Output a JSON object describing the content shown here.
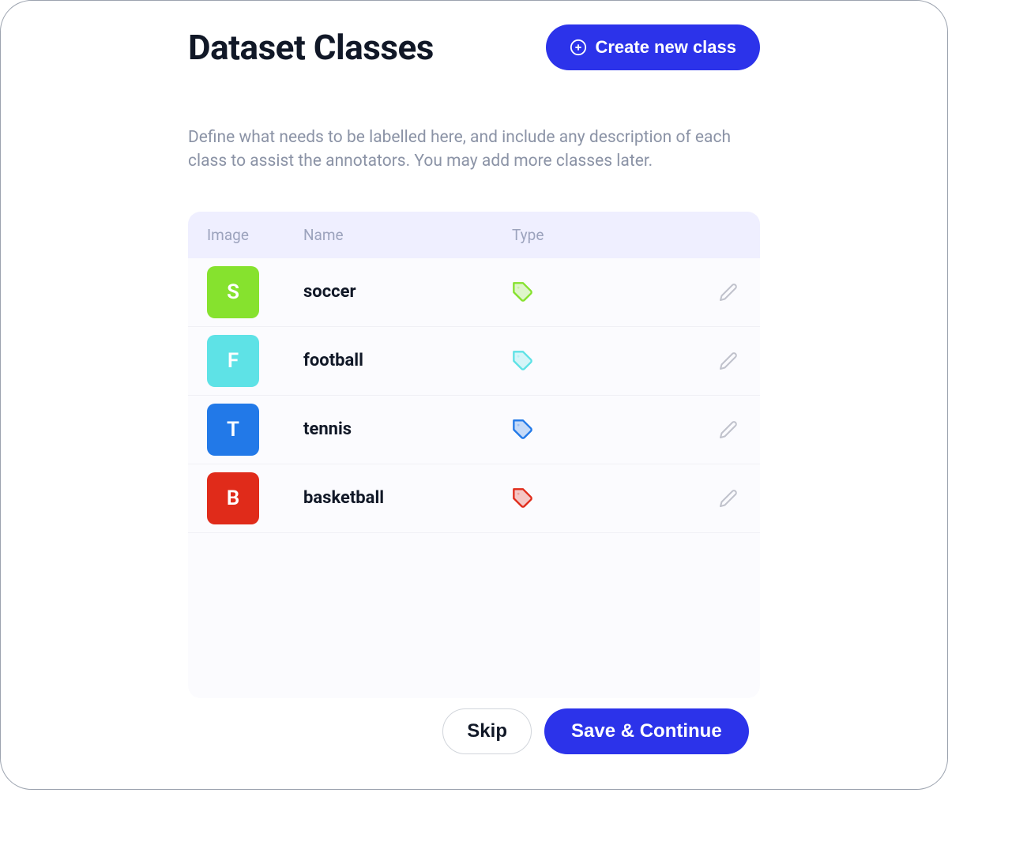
{
  "header": {
    "title": "Dataset Classes",
    "create_button": "Create new class"
  },
  "description": "Define what needs to be labelled here, and include any description of each class to assist the annotators. You may add more classes later.",
  "table": {
    "columns": {
      "image": "Image",
      "name": "Name",
      "type": "Type"
    },
    "rows": [
      {
        "letter": "S",
        "name": "soccer",
        "color": "#86e22e",
        "tag_color": "#86e22e"
      },
      {
        "letter": "F",
        "name": "football",
        "color": "#5ee2e6",
        "tag_color": "#5ee2e6"
      },
      {
        "letter": "T",
        "name": "tennis",
        "color": "#2279e8",
        "tag_color": "#2279e8"
      },
      {
        "letter": "B",
        "name": "basketball",
        "color": "#e02b1a",
        "tag_color": "#e02b1a"
      }
    ]
  },
  "footer": {
    "skip": "Skip",
    "save": "Save & Continue"
  }
}
